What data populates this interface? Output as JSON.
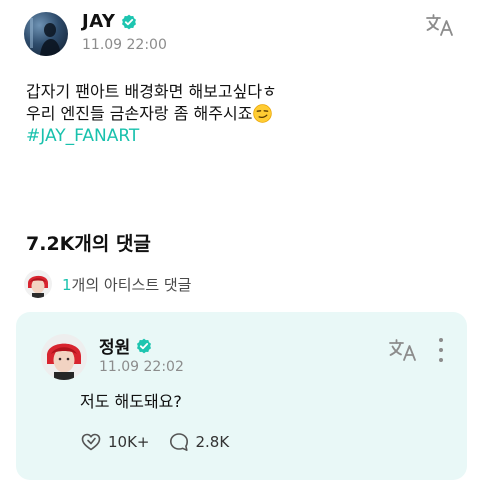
{
  "colors": {
    "accent": "#19c1ad",
    "verified": "#1dc5b0",
    "card_bg": "#e9f8f7",
    "muted": "#8c8c8c"
  },
  "post": {
    "author": "JAY",
    "time": "11.09 22:00",
    "lines": [
      "갑자기 팬아트 배경화면 해보고싶다ㅎ",
      "우리 엔진들 금손자랑 좀 해주시죠"
    ],
    "emoji": "smirking-face-icon",
    "hashtag": "#JAY_FANART",
    "translate_icon": "translate-icon"
  },
  "comments": {
    "title": "7.2K개의 댓글",
    "artist_count": "1",
    "artist_label": "개의 아티스트 댓글"
  },
  "comment": {
    "author": "정원",
    "time": "11.09 22:02",
    "text": "저도 해도돼요?",
    "likes": "10K+",
    "replies": "2.8K",
    "icons": [
      "translate-icon",
      "more-vertical-icon",
      "like-icon",
      "comment-bubble-icon"
    ]
  }
}
